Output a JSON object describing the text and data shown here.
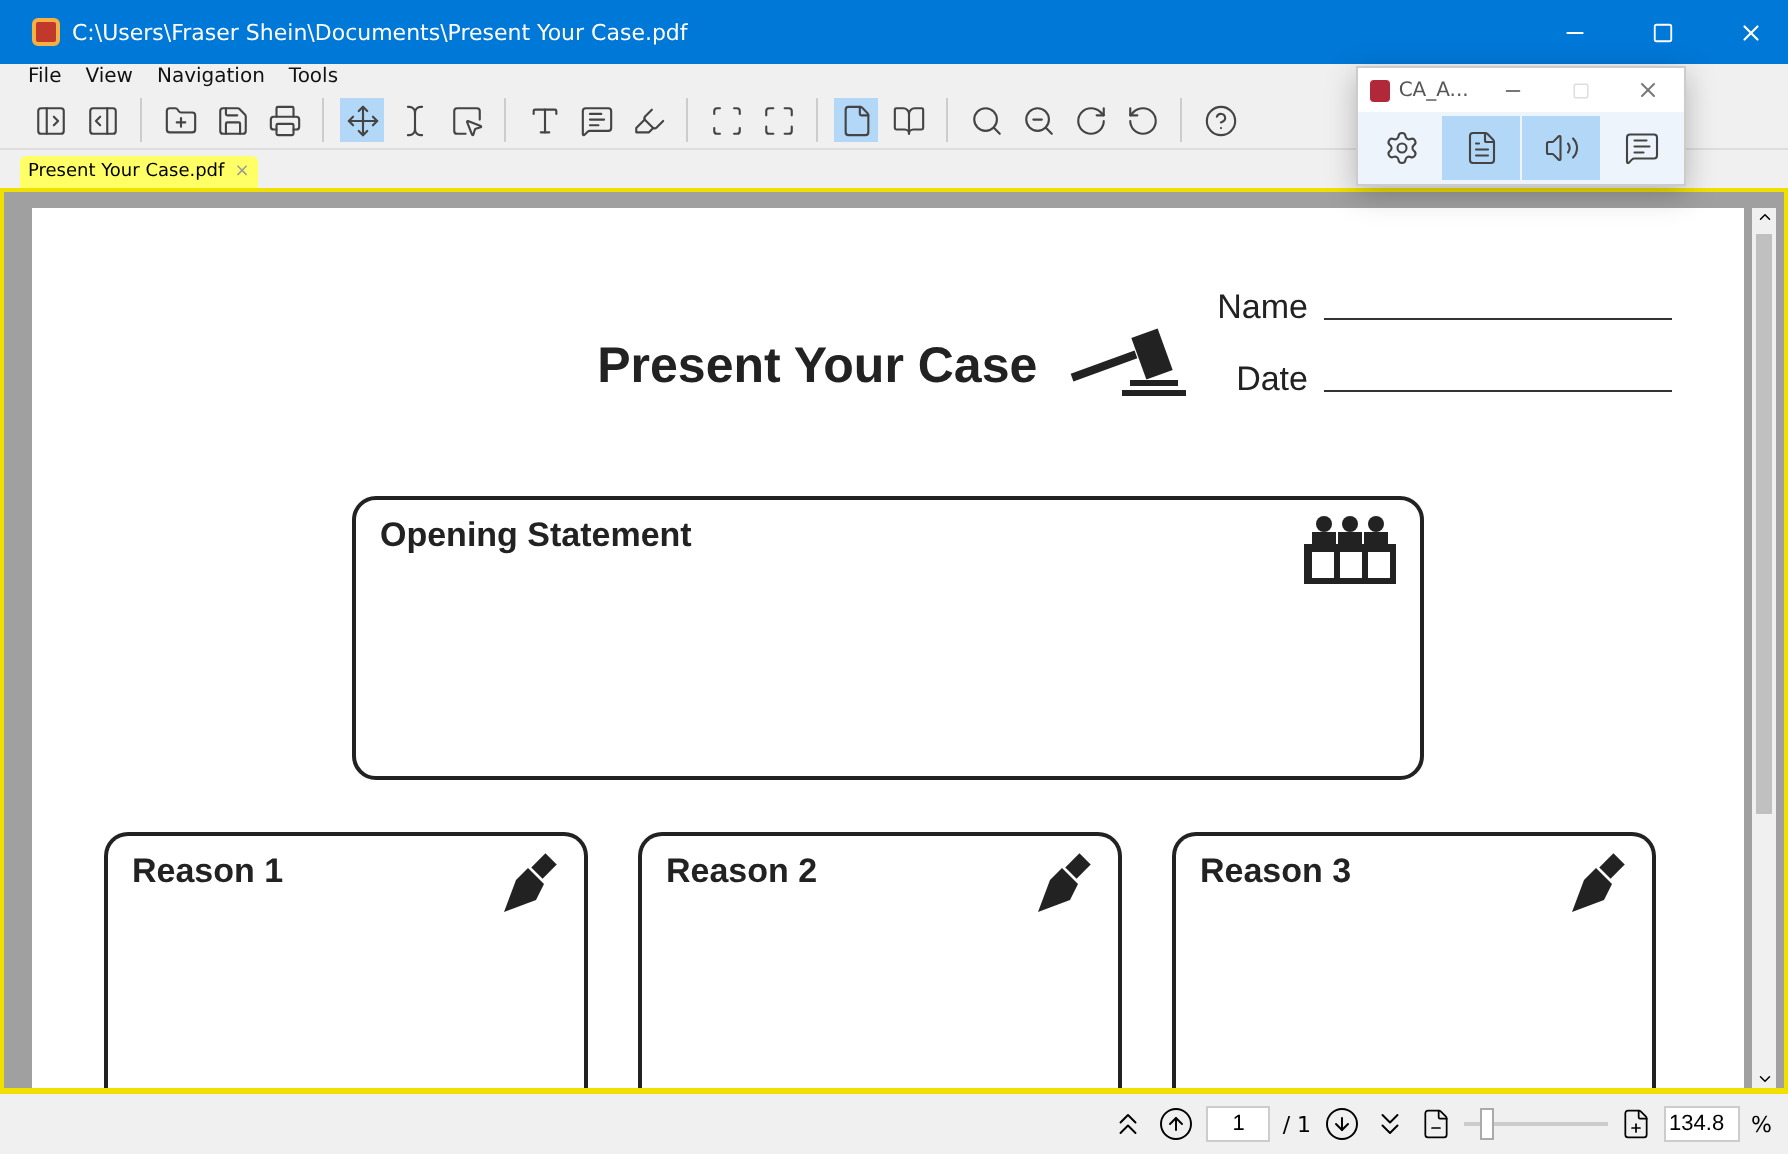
{
  "window": {
    "title": "C:\\Users\\Fraser Shein\\Documents\\Present Your Case.pdf"
  },
  "menu": [
    "File",
    "View",
    "Navigation",
    "Tools"
  ],
  "toolbar": [
    [
      {
        "selected": false
      },
      {
        "selected": false
      }
    ],
    [
      {
        "selected": false
      },
      {
        "selected": false
      },
      {
        "selected": false
      }
    ],
    [
      {
        "selected": true
      },
      {
        "selected": false
      },
      {
        "selected": false
      }
    ],
    [
      {
        "selected": false
      },
      {
        "selected": false
      },
      {
        "selected": false
      }
    ],
    [
      {
        "selected": false
      },
      {
        "selected": false
      }
    ],
    [
      {
        "selected": true
      },
      {
        "selected": false
      }
    ],
    [
      {
        "selected": false
      },
      {
        "selected": false
      },
      {
        "selected": false
      },
      {
        "selected": false
      }
    ],
    [
      {
        "selected": false
      }
    ]
  ],
  "tabs": [
    {
      "label": "Present Your Case.pdf",
      "close": "×",
      "selected": true
    }
  ],
  "document": {
    "title": "Present Your Case",
    "fields": [
      "Name",
      "Date"
    ],
    "opening": "Opening Statement",
    "reasons": [
      "Reason 1",
      "Reason 2",
      "Reason 3"
    ]
  },
  "status_bar": {
    "page": "1",
    "total": "/ 1",
    "zoom_slider": {
      "level": 0.12
    },
    "zoom": "134.8",
    "unit": "%"
  },
  "mini_window": {
    "title": "CA_A...",
    "buttons": [
      {
        "selected": false
      },
      {
        "selected": true
      },
      {
        "selected": true
      },
      {
        "selected": false
      }
    ]
  }
}
